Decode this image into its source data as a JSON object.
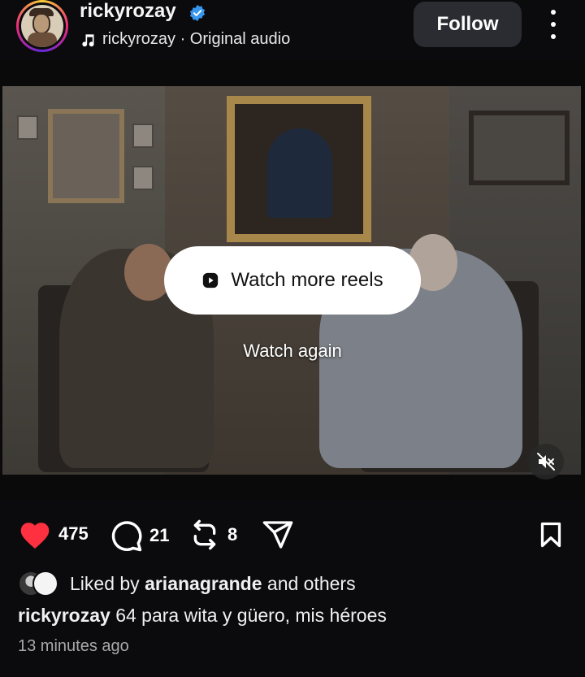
{
  "header": {
    "username": "rickyrozay",
    "audio": "rickyrozay · Original audio",
    "follow_label": "Follow"
  },
  "video": {
    "watch_more_label": "Watch more reels",
    "watch_again_label": "Watch again",
    "muted": true
  },
  "actions": {
    "likes": "475",
    "comments": "21",
    "reposts": "8"
  },
  "liked_by": {
    "prefix": "Liked by",
    "user": "arianagrande",
    "suffix": "and others"
  },
  "caption": {
    "user": "rickyrozay",
    "text": "64 para wita y güero, mis héroes"
  },
  "timestamp": "13 minutes ago",
  "colors": {
    "like_red": "#ff3040",
    "verified_blue": "#3797f0",
    "follow_bg": "#2a2c31"
  },
  "icons": [
    "music-note-icon",
    "verified-badge-icon",
    "more-options-icon",
    "play-icon",
    "muted-speaker-icon",
    "heart-icon",
    "comment-icon",
    "repost-icon",
    "share-icon",
    "bookmark-icon"
  ]
}
